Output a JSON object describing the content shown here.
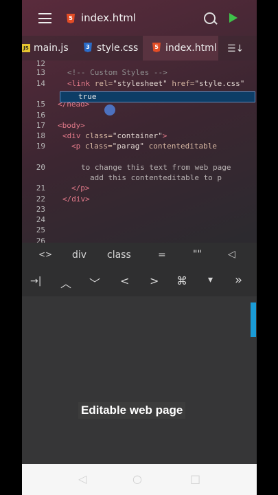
{
  "header": {
    "title": "index.html",
    "file_icon": "html5-icon",
    "colors": {
      "accent": "#3fc14a",
      "html5": "#e44d26",
      "css3": "#2a6cc9"
    }
  },
  "tabs": [
    {
      "label": "main.js",
      "icon": "js-icon",
      "active": false
    },
    {
      "label": "style.css",
      "icon": "css3-icon",
      "active": false
    },
    {
      "label": "index.html",
      "icon": "html5-icon",
      "active": true
    }
  ],
  "editor": {
    "lines": [
      {
        "n": "12",
        "parts": []
      },
      {
        "n": "13",
        "parts": [
          {
            "c": "cmt",
            "t": "<!-- Custom Styles -->"
          }
        ]
      },
      {
        "n": "14",
        "parts": [
          {
            "c": "tag",
            "t": "<link "
          },
          {
            "c": "attr",
            "t": "rel="
          },
          {
            "c": "str",
            "t": "\"stylesheet\" "
          },
          {
            "c": "attr",
            "t": "href="
          },
          {
            "c": "str",
            "t": "\"style.css\""
          }
        ]
      },
      {
        "n": "",
        "parts": [
          {
            "c": "tag",
            "t": ">"
          }
        ]
      },
      {
        "n": "15",
        "parts": [
          {
            "c": "tag",
            "t": "</head>"
          }
        ]
      },
      {
        "n": "16",
        "parts": []
      },
      {
        "n": "17",
        "parts": [
          {
            "c": "tag",
            "t": "<body>"
          }
        ]
      },
      {
        "n": "18",
        "parts": [
          {
            "c": "tag",
            "t": "<div "
          },
          {
            "c": "attr",
            "t": "class="
          },
          {
            "c": "str",
            "t": "\"container\""
          },
          {
            "c": "tag",
            "t": ">"
          }
        ]
      },
      {
        "n": "19",
        "parts": [
          {
            "c": "tag",
            "t": "<p "
          },
          {
            "c": "attr",
            "t": "class="
          },
          {
            "c": "str",
            "t": "\"parag\" "
          },
          {
            "c": "attr",
            "t": "contenteditable"
          }
        ]
      },
      {
        "n": "",
        "parts": []
      },
      {
        "n": "20",
        "parts": [
          {
            "c": "txt",
            "t": "to change this text from web page"
          }
        ]
      },
      {
        "n": "",
        "parts": [
          {
            "c": "txt",
            "t": "add this contenteditable to p"
          }
        ]
      },
      {
        "n": "21",
        "parts": [
          {
            "c": "tag",
            "t": "</p>"
          }
        ]
      },
      {
        "n": "22",
        "parts": [
          {
            "c": "tag",
            "t": "</div>"
          }
        ]
      },
      {
        "n": "23",
        "parts": []
      },
      {
        "n": "24",
        "parts": []
      },
      {
        "n": "25",
        "parts": []
      },
      {
        "n": "26",
        "parts": []
      }
    ],
    "autocomplete": "true"
  },
  "keys_row1": [
    "<>",
    "div",
    "class",
    "=",
    "\"\""
  ],
  "keys_row1_icons": [
    "send-icon"
  ],
  "keys_row2": [
    "→|",
    "^",
    "v",
    "<",
    ">",
    "⌘",
    "▾",
    "»"
  ],
  "caption": "Editable web page"
}
